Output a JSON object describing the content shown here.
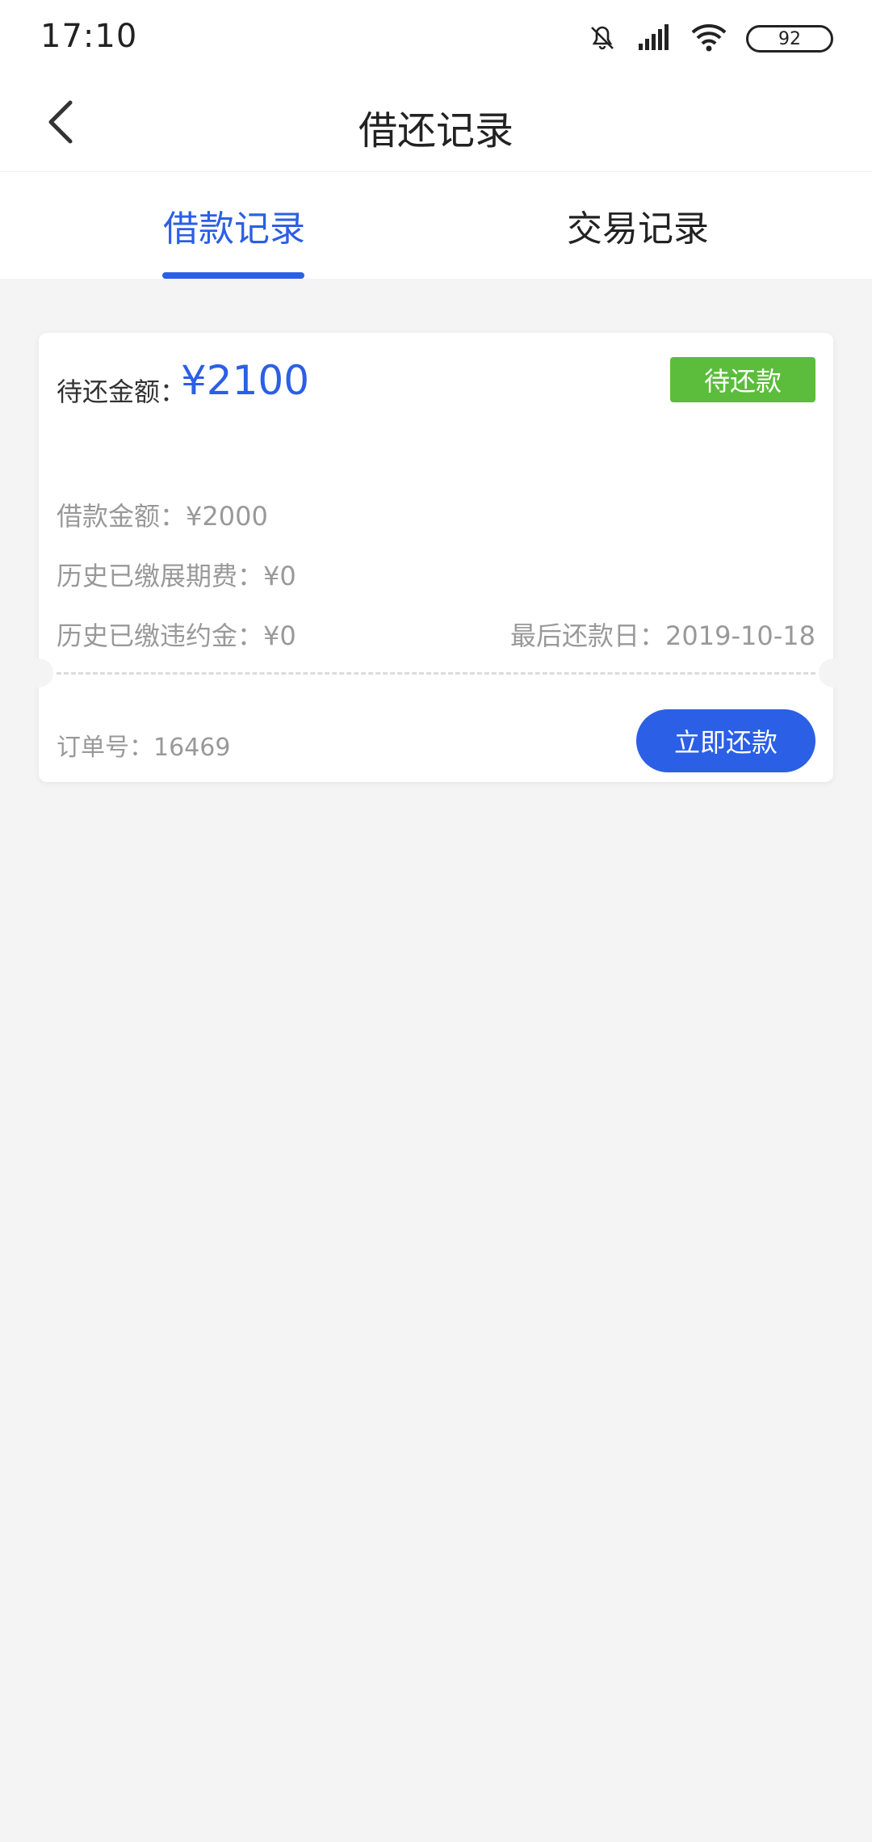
{
  "status_bar": {
    "time": "17:10",
    "battery": "92",
    "icons": [
      "bell-muted-icon",
      "signal-icon",
      "wifi-icon",
      "battery-icon"
    ]
  },
  "nav": {
    "title": "借还记录",
    "back_icon": "chevron-left-icon"
  },
  "tabs": [
    {
      "label": "借款记录",
      "active": true
    },
    {
      "label": "交易记录",
      "active": false
    }
  ],
  "card": {
    "amount_label": "待还金额：",
    "amount_value": "¥2100",
    "status": "待还款",
    "loan_amount": "借款金额：¥2000",
    "extension_fee": "历史已缴展期费：¥0",
    "penalty": "历史已缴违约金：¥0",
    "due_date": "最后还款日：2019-10-18",
    "order_no": "订单号：16469",
    "repay_button": "立即还款"
  },
  "colors": {
    "accent": "#2b5fe6",
    "status_badge": "#5bbd3b",
    "background": "#f4f4f4"
  }
}
